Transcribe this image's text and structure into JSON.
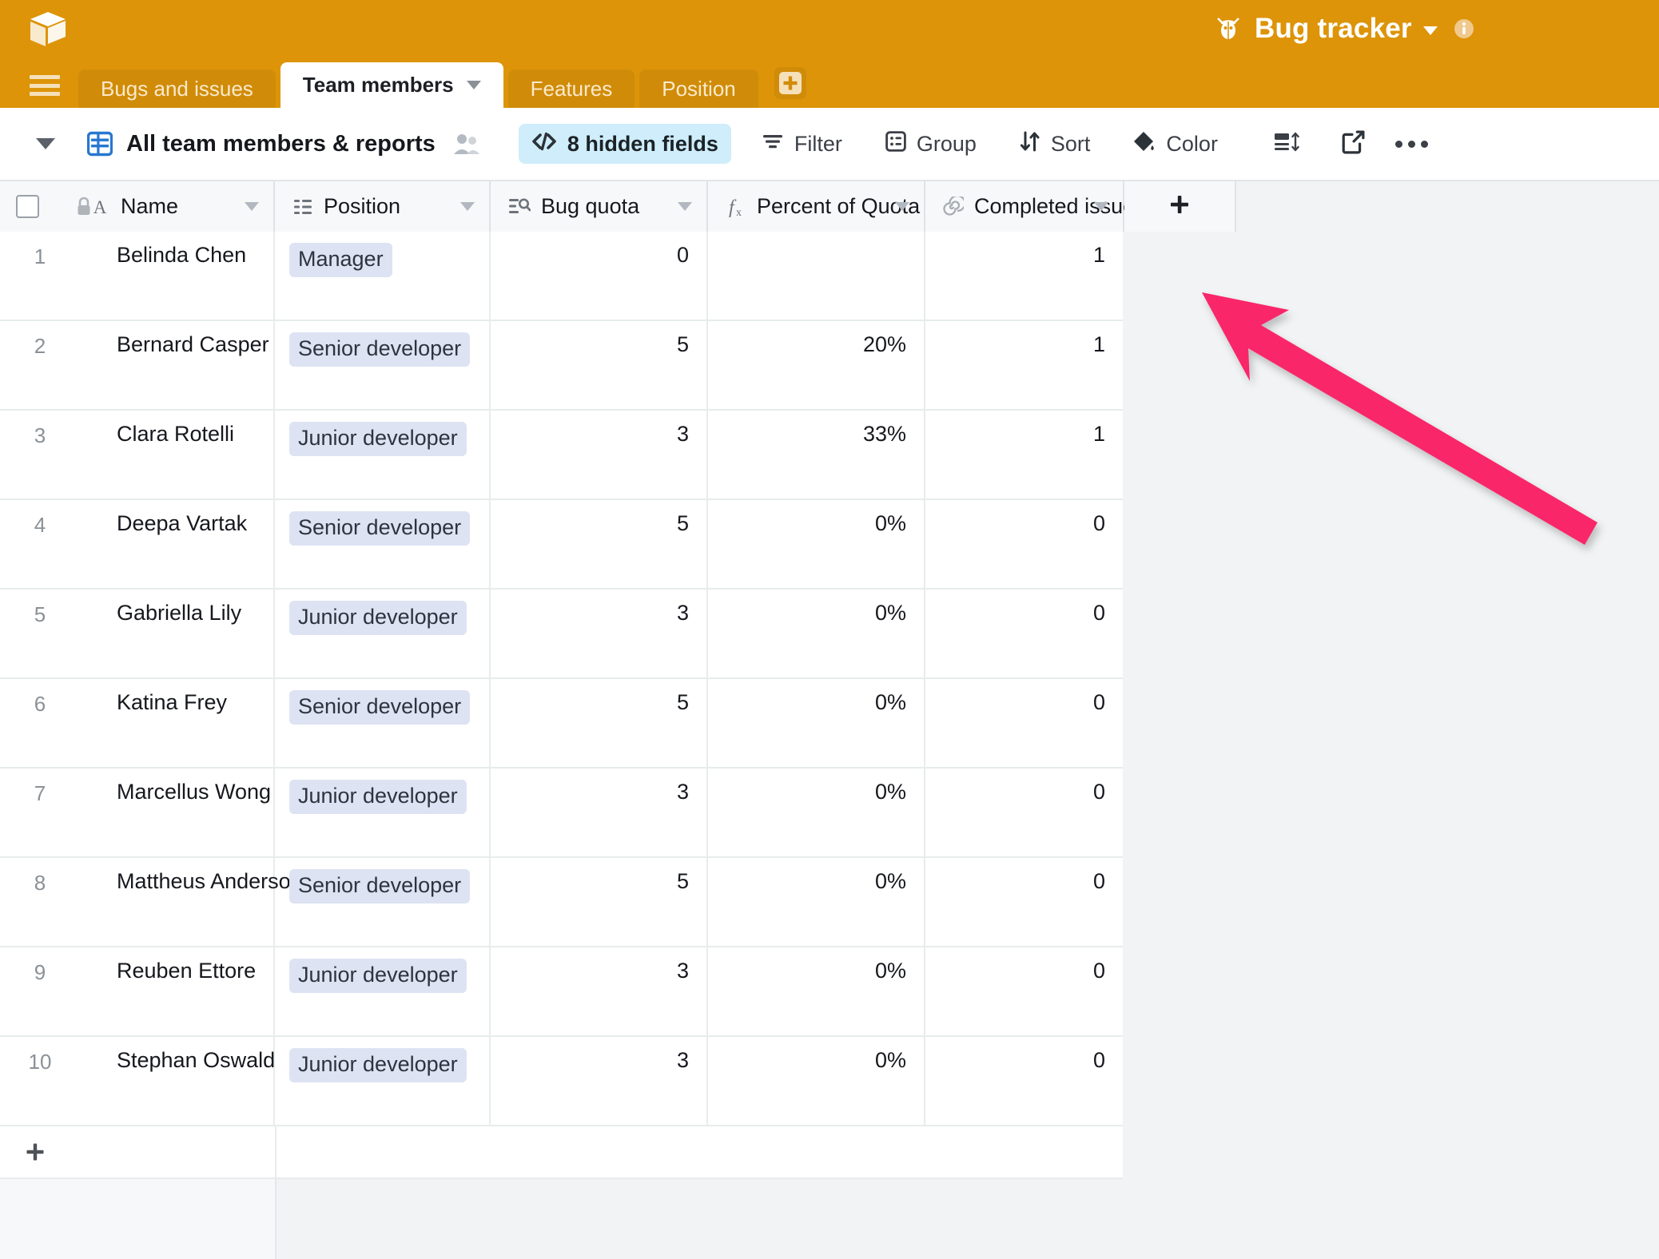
{
  "app": {
    "logo_icon": "airtable-cube-logo",
    "base_title": "Bug tracker",
    "base_caret_icon": "chevron-down-icon",
    "base_emoji_icon": "bug-icon",
    "info_icon": "info-circle-icon",
    "brand_color": "#dd9409"
  },
  "tabs": {
    "menu_icon": "hamburger-menu-icon",
    "items": [
      {
        "label": "Bugs and issues",
        "active": false
      },
      {
        "label": "Team members",
        "active": true
      },
      {
        "label": "Features",
        "active": false
      },
      {
        "label": "Position",
        "active": false
      }
    ],
    "add_tab_icon": "add-table-icon",
    "active_tab_caret_icon": "chevron-down-icon"
  },
  "toolbar": {
    "sidebar_toggle_icon": "chevron-down-icon",
    "view_type_icon": "grid-view-icon",
    "view_name": "All team members & reports",
    "collaborators_icon": "collaborators-icon",
    "hidden_fields": {
      "label": "8 hidden fields",
      "icon": "hidden-fields-icon",
      "active_color": "#cfedfb"
    },
    "filter": {
      "label": "Filter",
      "icon": "filter-icon"
    },
    "group": {
      "label": "Group",
      "icon": "group-icon"
    },
    "sort": {
      "label": "Sort",
      "icon": "sort-icon"
    },
    "color": {
      "label": "Color",
      "icon": "paint-bucket-icon"
    },
    "row_height_icon": "row-height-icon",
    "share_icon": "share-external-icon",
    "more_icon": "more-horizontal-icon"
  },
  "grid": {
    "select_all_icon": "checkbox-unchecked-icon",
    "lock_icon": "lock-icon",
    "add_field_icon": "plus-icon",
    "add_row_icon": "plus-icon",
    "columns": [
      {
        "name": "Name",
        "icon": "text-field-icon",
        "caret": "chevron-down-icon"
      },
      {
        "name": "Position",
        "icon": "single-select-icon",
        "caret": "chevron-down-icon"
      },
      {
        "name": "Bug quota",
        "icon": "lookup-icon",
        "caret": "chevron-down-icon"
      },
      {
        "name": "Percent of Quota",
        "icon": "formula-icon",
        "caret": "chevron-down-icon"
      },
      {
        "name": "Completed issues",
        "icon": "count-icon",
        "caret": "chevron-down-icon"
      }
    ],
    "rows": [
      {
        "num": "1",
        "name": "Belinda Chen",
        "position": "Manager",
        "bug_quota": "0",
        "percent_of_quota": "",
        "completed_issues": "1"
      },
      {
        "num": "2",
        "name": "Bernard Casper",
        "position": "Senior developer",
        "bug_quota": "5",
        "percent_of_quota": "20%",
        "completed_issues": "1"
      },
      {
        "num": "3",
        "name": "Clara Rotelli",
        "position": "Junior developer",
        "bug_quota": "3",
        "percent_of_quota": "33%",
        "completed_issues": "1"
      },
      {
        "num": "4",
        "name": "Deepa Vartak",
        "position": "Senior developer",
        "bug_quota": "5",
        "percent_of_quota": "0%",
        "completed_issues": "0"
      },
      {
        "num": "5",
        "name": "Gabriella Lily",
        "position": "Junior developer",
        "bug_quota": "3",
        "percent_of_quota": "0%",
        "completed_issues": "0"
      },
      {
        "num": "6",
        "name": "Katina Frey",
        "position": "Senior developer",
        "bug_quota": "5",
        "percent_of_quota": "0%",
        "completed_issues": "0"
      },
      {
        "num": "7",
        "name": "Marcellus Wong",
        "position": "Junior developer",
        "bug_quota": "3",
        "percent_of_quota": "0%",
        "completed_issues": "0"
      },
      {
        "num": "8",
        "name": "Mattheus Anderson",
        "position": "Senior developer",
        "bug_quota": "5",
        "percent_of_quota": "0%",
        "completed_issues": "0"
      },
      {
        "num": "9",
        "name": "Reuben Ettore",
        "position": "Junior developer",
        "bug_quota": "3",
        "percent_of_quota": "0%",
        "completed_issues": "0"
      },
      {
        "num": "10",
        "name": "Stephan Oswald",
        "position": "Junior developer",
        "bug_quota": "3",
        "percent_of_quota": "0%",
        "completed_issues": "0"
      }
    ]
  },
  "annotation": {
    "arrow_icon": "pointer-arrow-annotation",
    "color": "#f9276b"
  }
}
